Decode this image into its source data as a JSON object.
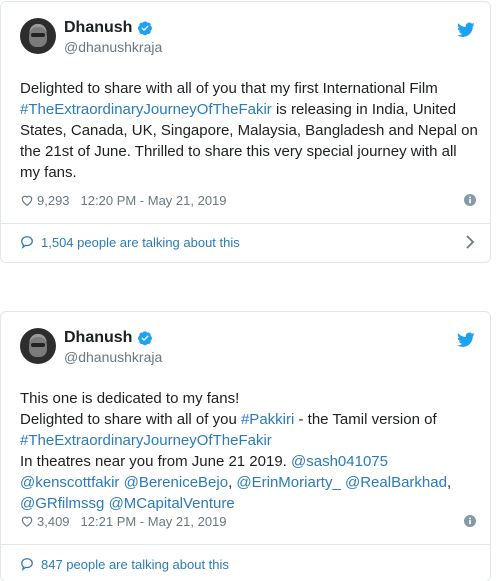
{
  "tweets": [
    {
      "author_name": "Dhanush",
      "handle": "@dhanushkraja",
      "text_html": "Delighted to share with all of you that my first International Film <span class=\"link\">#TheExtraordinaryJourneyOfTheFakir</span> is releasing in India, United States, Canada, UK, Singapore, Malaysia, Bangladesh and Nepal on the 21st of June. Thrilled to share this very special journey with all my fans.",
      "text_plain": "Delighted to share with all of you that my first International Film #TheExtraordinaryJourneyOfTheFakir is releasing in India, United States, Canada, UK, Singapore, Malaysia, Bangladesh and Nepal on the 21st of June. Thrilled to share this very special journey with all my fans.",
      "likes": "9,293",
      "timestamp": "12:20 PM - May 21, 2019",
      "talking": "1,504 people are talking about this"
    },
    {
      "author_name": "Dhanush",
      "handle": "@dhanushkraja",
      "text_html": "This one is dedicated to my fans!<br>Delighted to share with all of you <span class=\"link\">#Pakkiri</span> - the Tamil version of <span class=\"link\">#TheExtraordinaryJourneyOfTheFakir</span><br>In theatres near you from June 21 2019. <span class=\"link\">@sash041075</span> <span class=\"link\">@kenscottfakir</span> <span class=\"link\">@BereniceBejo</span>, <span class=\"link\">@ErinMoriarty_</span> <span class=\"link\">@RealBarkhad</span>, <span class=\"link\">@GRfilmssg</span> <span class=\"link\">@MCapitalVenture</span>",
      "text_plain": "This one is dedicated to my fans! Delighted to share with all of you #Pakkiri - the Tamil version of #TheExtraordinaryJourneyOfTheFakir In theatres near you from June 21 2019. @sash041075 @kenscottfakir @BereniceBejo, @ErinMoriarty_ @RealBarkhad, @GRfilmssg @MCapitalVenture",
      "likes": "3,409",
      "timestamp": "12:21 PM - May 21, 2019",
      "talking": "847 people are talking about this"
    }
  ],
  "colors": {
    "link": "#2b7bb9",
    "muted": "#697882",
    "border": "#e1e8ed",
    "twitter_blue": "#1da1f2"
  },
  "icons": [
    "avatar",
    "verified-badge-icon",
    "twitter-bird-icon",
    "heart-icon",
    "info-icon",
    "speech-bubble-icon",
    "chevron-right-icon"
  ]
}
